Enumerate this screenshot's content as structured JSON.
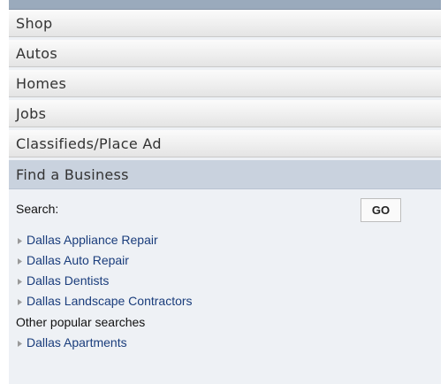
{
  "nav": {
    "items": [
      {
        "label": "Shop"
      },
      {
        "label": "Autos"
      },
      {
        "label": "Homes"
      },
      {
        "label": "Jobs"
      },
      {
        "label": "Classifieds/Place Ad"
      }
    ],
    "active_label": "Find a Business"
  },
  "business": {
    "search_label": "Search:",
    "go_label": "GO",
    "links": [
      {
        "label": "Dallas Appliance Repair"
      },
      {
        "label": "Dallas Auto Repair"
      },
      {
        "label": "Dallas Dentists"
      },
      {
        "label": "Dallas Landscape Contractors"
      }
    ],
    "other_heading": "Other popular searches",
    "other_links": [
      {
        "label": "Dallas Apartments"
      }
    ]
  },
  "icons": {
    "bullet": "triangle-bullet-icon"
  },
  "colors": {
    "top_strip": "#9aaabc",
    "active_tab": "#c9d2de",
    "panel_bg": "#eef1f5",
    "link": "#1a3d7c"
  }
}
